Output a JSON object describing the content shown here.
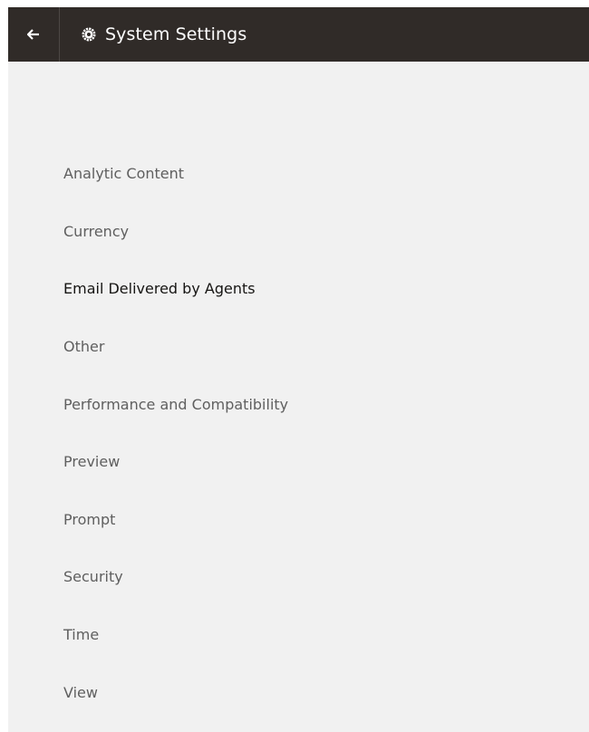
{
  "header": {
    "title": "System Settings",
    "back_icon": "back-arrow-icon",
    "title_icon": "gear-icon",
    "background_color": "#302b28"
  },
  "nav": {
    "selected": "Email Delivered by Agents",
    "items": [
      {
        "label": "Analytic Content"
      },
      {
        "label": "Currency"
      },
      {
        "label": "Email Delivered by Agents"
      },
      {
        "label": "Other"
      },
      {
        "label": "Performance and Compatibility"
      },
      {
        "label": "Preview"
      },
      {
        "label": "Prompt"
      },
      {
        "label": "Security"
      },
      {
        "label": "Time"
      },
      {
        "label": "View"
      }
    ]
  },
  "colors": {
    "panel_background": "#f1f1f1",
    "item_text": "#5f5f5f",
    "active_item_text": "#161513"
  }
}
